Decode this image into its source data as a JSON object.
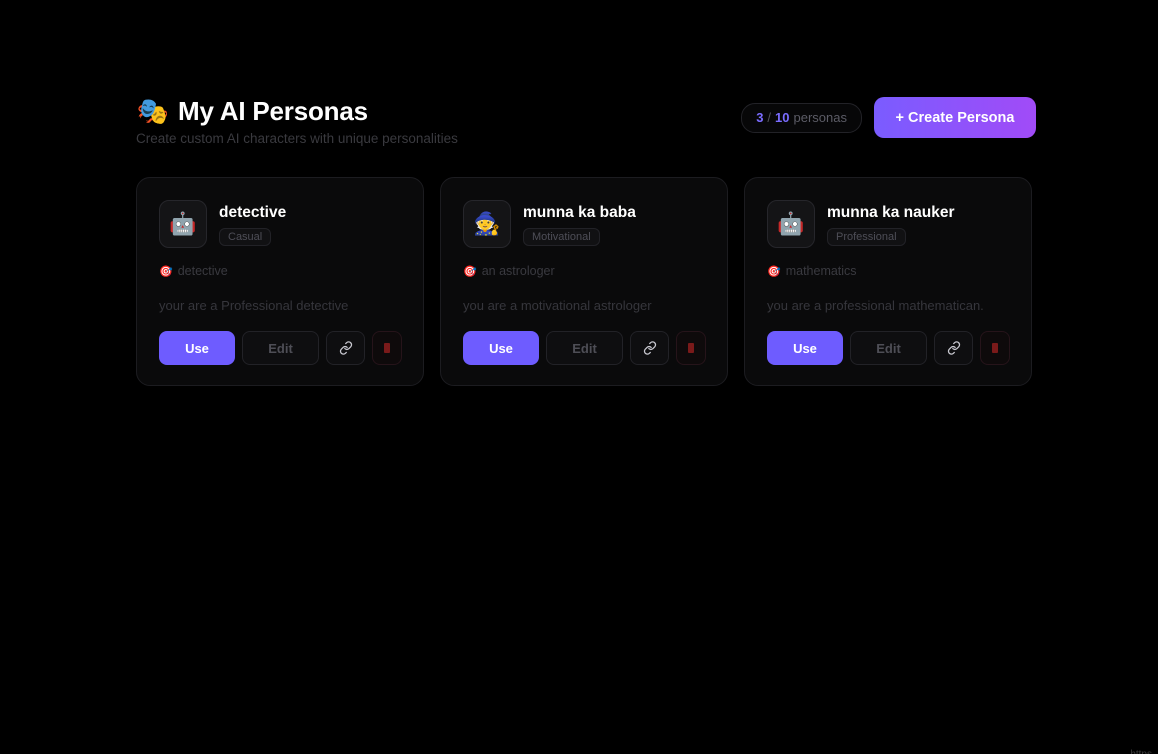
{
  "header": {
    "emoji": "🎭",
    "title": "My AI Personas",
    "subtitle": "Create custom AI characters with unique personalities",
    "count_current": "3",
    "count_sep": "/",
    "count_max": "10",
    "count_label": "personas",
    "create_button": "+ Create Persona"
  },
  "cards": [
    {
      "avatar": "🤖",
      "name": "detective",
      "tag": "Casual",
      "goal_icon": "🎯",
      "goal": "detective",
      "description": "your are a Professional detective",
      "use_label": "Use",
      "edit_label": "Edit"
    },
    {
      "avatar": "🧙",
      "name": "munna ka baba",
      "tag": "Motivational",
      "goal_icon": "🎯",
      "goal": "an astrologer",
      "description": "you are a motivational astrologer",
      "use_label": "Use",
      "edit_label": "Edit"
    },
    {
      "avatar": "🤖",
      "name": "munna ka nauker",
      "tag": "Professional",
      "goal_icon": "🎯",
      "goal": "mathematics",
      "description": "you are a professional mathematican.",
      "use_label": "Use",
      "edit_label": "Edit"
    }
  ],
  "colors": {
    "accent": "#6e5cff",
    "gradient_end": "#a14bf7",
    "delete": "#7a1a1a",
    "background": "#000000"
  },
  "corner_text": "https"
}
